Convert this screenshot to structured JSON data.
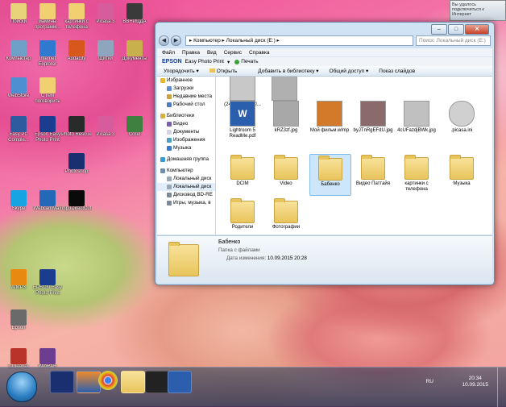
{
  "desktop_icons": [
    {
      "label": "Поиски",
      "color": "#e8d27a"
    },
    {
      "label": "мамины программ...",
      "color": "#f0d070"
    },
    {
      "label": "картинки с телефона",
      "color": "#f0d070"
    },
    {
      "label": "Picasa 3",
      "color": "#d65c9e"
    },
    {
      "label": "ВВНИЦДА",
      "color": "#3a3a3a"
    },
    {
      "label": "Компьютер",
      "color": "#6fa0c8"
    },
    {
      "label": "Internet Explorer",
      "color": "#2f7ad0"
    },
    {
      "label": "Audacity",
      "color": "#d8581c"
    },
    {
      "label": "Щитки",
      "color": "#8da6bd"
    },
    {
      "label": "Документы",
      "color": "#c8b04c"
    },
    {
      "label": "WebStore",
      "color": "#4d8fd0"
    },
    {
      "label": "С кем поговорить",
      "color": "#f0d070"
    },
    {
      "label": "Easy PC Comple...",
      "color": "#2e5a9e"
    },
    {
      "label": "Epson Easy Photo Print",
      "color": "#1a3d8f"
    },
    {
      "label": "Photo Rescue",
      "color": "#2a2a2a"
    },
    {
      "label": "Picasa 3",
      "color": "#d65c9e"
    },
    {
      "label": "Corel",
      "color": "#3f7f3f"
    },
    {
      "label": "Photoshop",
      "color": "#1a2f6f"
    },
    {
      "label": "Skype",
      "color": "#16a4e3"
    },
    {
      "label": "WebcamMax",
      "color": "#2468b8"
    },
    {
      "label": "mp3DirectCut",
      "color": "#0a0a0a"
    },
    {
      "label": "AIMP3",
      "color": "#e88a10"
    },
    {
      "label": "EPSON Easy Photo Print",
      "color": "#1a3d8f"
    },
    {
      "label": "Epson",
      "color": "#6a6a6a"
    },
    {
      "label": "CCleaner",
      "color": "#b8342a"
    },
    {
      "label": "WinRAR",
      "color": "#6b3e8f"
    }
  ],
  "window": {
    "address": "▸ Компьютер ▸ Локальный диск (E:) ▸",
    "search_placeholder": "Поиск: Локальный диск (E:)",
    "menus": [
      "Файл",
      "Правка",
      "Вид",
      "Сервис",
      "Справка"
    ],
    "epson": {
      "logo": "EPSON",
      "app": "Easy Photo Print",
      "print": "Печать"
    },
    "toolbar": [
      "Упорядочить ▾",
      "Открыть",
      "Добавить в библиотеку ▾",
      "Общий доступ ▾",
      "Показ слайдов"
    ],
    "nav": {
      "favorites": "Избранное",
      "fav_items": [
        "Загрузки",
        "Недавние места",
        "Рабочий стол"
      ],
      "libraries": "Библиотеки",
      "lib_items": [
        "Видео",
        "Документы",
        "Изображения",
        "Музыка"
      ],
      "homegroup": "Домашняя группа",
      "computer": "Компьютер",
      "comp_items": [
        "Локальный диск",
        "Локальный диск",
        "Дисковод BD-RE",
        "Игры, музыка, в"
      ]
    },
    "files": [
      {
        "name": "(24-02-2014) ©...",
        "type": "doc",
        "color": "#c8c8c8"
      },
      {
        "name": "p3",
        "type": "img",
        "color": "#b0b0b0"
      },
      {
        "name": "Lightroom 5 ReadMe.pdf",
        "type": "word",
        "color": "#2b5fae"
      },
      {
        "name": "kRZ3zf.jpg",
        "type": "img",
        "color": "#a8a8a8"
      },
      {
        "name": "Мой фильм.wlmp",
        "type": "film",
        "color": "#d27a2a"
      },
      {
        "name": "byJTnRgEFdU.jpg",
        "type": "img",
        "color": "#8a6a6a"
      },
      {
        "name": "4cUFazdjBWk.jpg",
        "type": "img",
        "color": "#c0c0c0"
      },
      {
        "name": ".picasa.ini",
        "type": "gear",
        "color": "#d0d0d0"
      },
      {
        "name": "DCIM",
        "type": "folder"
      },
      {
        "name": "Video",
        "type": "folder"
      },
      {
        "name": "Бабенко",
        "type": "folder",
        "selected": true
      },
      {
        "name": "Видео Паттайя",
        "type": "folder"
      },
      {
        "name": "картинки с телефона",
        "type": "folder"
      },
      {
        "name": "Музыка",
        "type": "folder"
      },
      {
        "name": "Родители",
        "type": "folder"
      },
      {
        "name": "Фотографии",
        "type": "folder"
      }
    ],
    "details": {
      "name": "Бабенко",
      "kind": "Папка с файлами",
      "modified_label": "Дата изменения:",
      "modified_value": "10.09.2015 20:28"
    }
  },
  "taskbar": {
    "lang": "RU",
    "time": "20:34",
    "date": "10.09.2015"
  },
  "notify": {
    "text": "Вы удалось подключиться к Интернет"
  }
}
